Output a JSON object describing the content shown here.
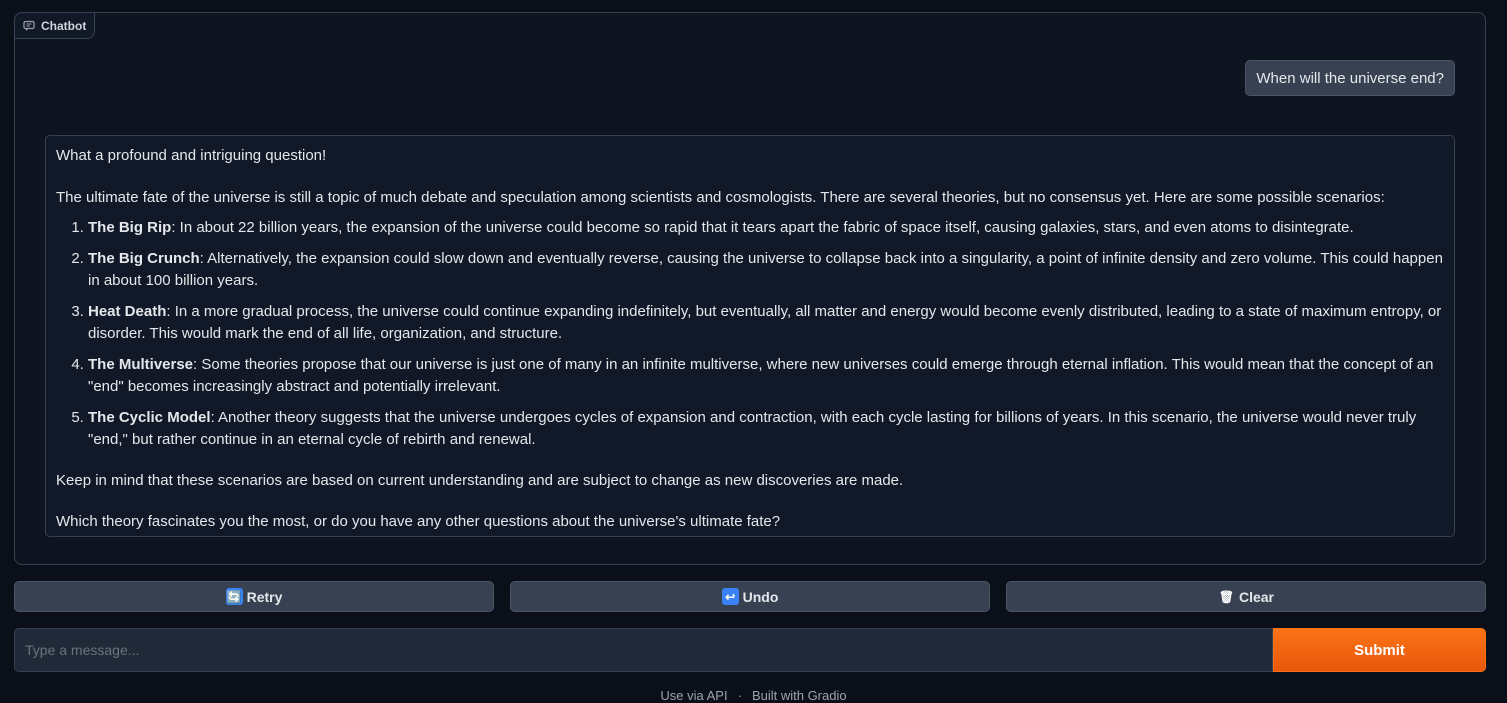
{
  "chatbot": {
    "label": "Chatbot",
    "label_icon": "chat-icon",
    "user_message": "When will the universe end?",
    "bot": {
      "intro": "What a profound and intriguing question!",
      "lead": "The ultimate fate of the universe is still a topic of much debate and speculation among scientists and cosmologists. There are several theories, but no consensus yet. Here are some possible scenarios:",
      "items": [
        {
          "title": "The Big Rip",
          "text": ": In about 22 billion years, the expansion of the universe could become so rapid that it tears apart the fabric of space itself, causing galaxies, stars, and even atoms to disintegrate."
        },
        {
          "title": "The Big Crunch",
          "text": ": Alternatively, the expansion could slow down and eventually reverse, causing the universe to collapse back into a singularity, a point of infinite density and zero volume. This could happen in about 100 billion years."
        },
        {
          "title": "Heat Death",
          "text": ": In a more gradual process, the universe could continue expanding indefinitely, but eventually, all matter and energy would become evenly distributed, leading to a state of maximum entropy, or disorder. This would mark the end of all life, organization, and structure."
        },
        {
          "title": "The Multiverse",
          "text": ": Some theories propose that our universe is just one of many in an infinite multiverse, where new universes could emerge through eternal inflation. This would mean that the concept of an \"end\" becomes increasingly abstract and potentially irrelevant."
        },
        {
          "title": "The Cyclic Model",
          "text": ": Another theory suggests that the universe undergoes cycles of expansion and contraction, with each cycle lasting for billions of years. In this scenario, the universe would never truly \"end,\" but rather continue in an eternal cycle of rebirth and renewal."
        }
      ],
      "keep_in_mind": "Keep in mind that these scenarios are based on current understanding and are subject to change as new discoveries are made.",
      "question": "Which theory fascinates you the most, or do you have any other questions about the universe's ultimate fate?"
    }
  },
  "actions": {
    "retry": {
      "label": "Retry",
      "icon": "retry-icon",
      "glyph": "🔄"
    },
    "undo": {
      "label": "Undo",
      "icon": "undo-icon",
      "glyph": "↩"
    },
    "clear": {
      "label": "Clear",
      "icon": "trash-icon",
      "glyph": "🗑"
    }
  },
  "input": {
    "placeholder": "Type a message...",
    "value": "",
    "submit_label": "Submit"
  },
  "footer": {
    "api_link": "Use via API",
    "built_with": "Built with Gradio"
  },
  "colors": {
    "background": "#0b0f19",
    "accent": "#f97316"
  }
}
